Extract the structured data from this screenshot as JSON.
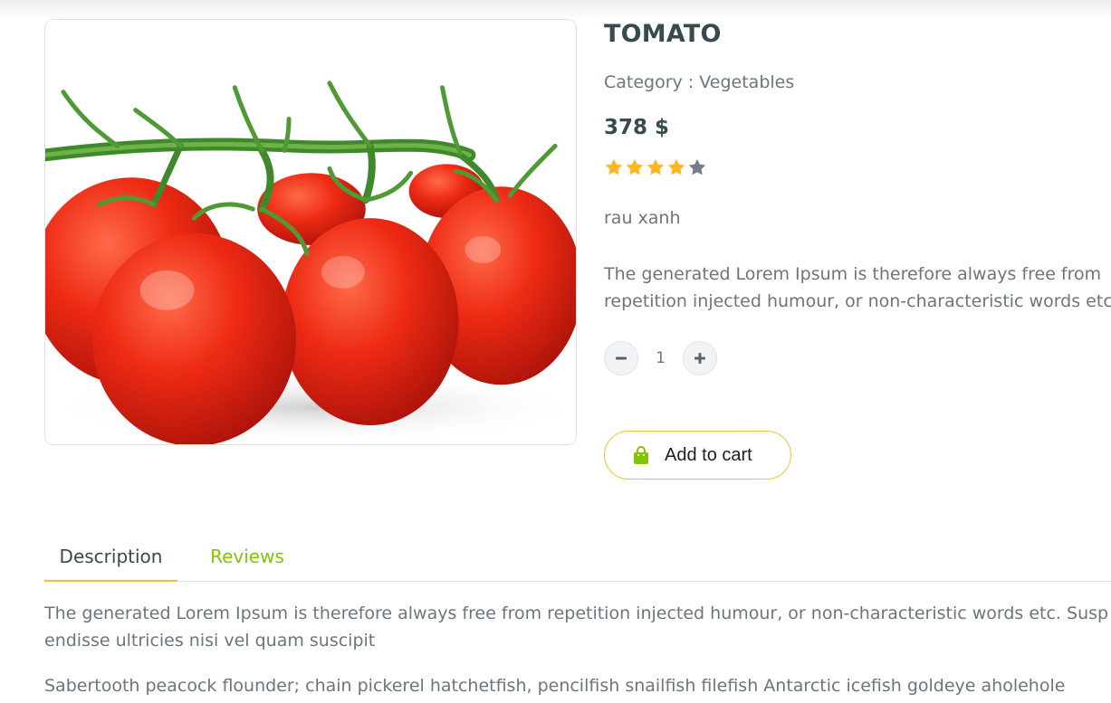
{
  "product": {
    "name": "TOMATO",
    "category": "Category : Vegetables",
    "price": "378 $",
    "rating": 4,
    "rating_max": 5,
    "short_name": "rau xanh",
    "short_description_line1": "The generated Lorem Ipsum is therefore always free from",
    "short_description_line2": "repetition injected humour, or non-characteristic words etc.",
    "image_icon": "tomato-vine-photo"
  },
  "quantity": {
    "decrement_icon": "minus-icon",
    "value": "1",
    "increment_icon": "plus-icon"
  },
  "cart": {
    "label": "Add to cart",
    "icon": "shopping-bag-icon"
  },
  "tabs": [
    {
      "label": "Description",
      "active": true
    },
    {
      "label": "Reviews",
      "active": false
    }
  ],
  "description": {
    "paragraph1": "The generated Lorem Ipsum is therefore always free from repetition injected humour, or non-characteristic words etc. Susp endisse ultricies nisi vel quam suscipit",
    "paragraph2": "Sabertooth peacock flounder; chain pickerel hatchetfish, pencilfish snailfish filefish Antarctic icefish goldeye aholehole"
  },
  "colors": {
    "title": "#374b4f",
    "text": "#6c757d",
    "star_filled": "#ffb524",
    "star_empty": "#747d88",
    "accent_green": "#81c408",
    "accent_yellow": "#f1c232"
  }
}
